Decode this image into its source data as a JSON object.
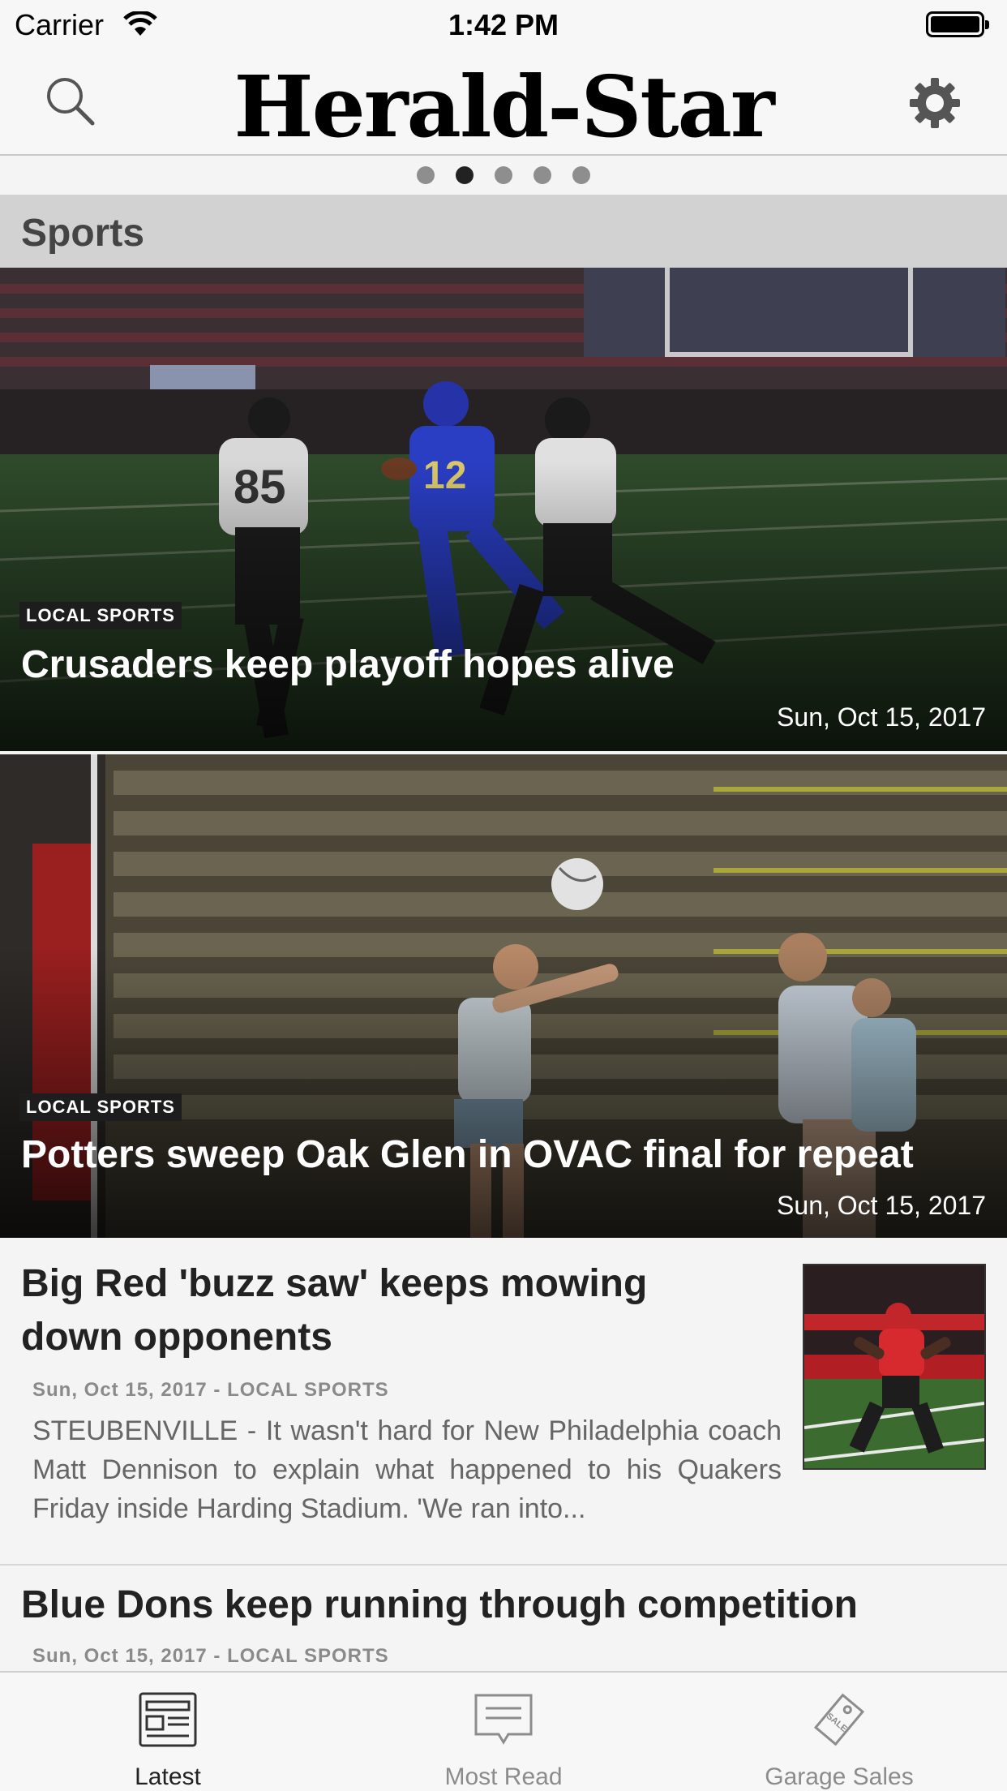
{
  "status_bar": {
    "carrier": "Carrier",
    "time": "1:42 PM"
  },
  "header": {
    "logo": "Herald-Star"
  },
  "pager": {
    "count": 5,
    "active_index": 1
  },
  "section": {
    "title": "Sports"
  },
  "hero_stories": [
    {
      "tag": "LOCAL SPORTS",
      "title": "Crusaders keep playoff hopes alive",
      "date": "Sun, Oct 15, 2017"
    },
    {
      "tag": "LOCAL SPORTS",
      "title": "Potters sweep Oak Glen in OVAC final for repeat",
      "date": "Sun, Oct 15, 2017"
    }
  ],
  "articles": [
    {
      "title": "Big Red 'buzz saw' keeps mowing down opponents",
      "meta": "Sun, Oct 15, 2017 - LOCAL SPORTS",
      "snippet": "STEUBENVILLE - It wasn't hard for New Philadelphia coach Matt Dennison to explain what happened to his Quakers Friday inside Harding Stadium. 'We ran into..."
    },
    {
      "title": "Blue Dons keep running through competition",
      "meta": "Sun, Oct 15, 2017 - LOCAL SPORTS"
    }
  ],
  "tabs": [
    {
      "label": "Latest",
      "icon": "newspaper-icon",
      "active": true
    },
    {
      "label": "Most Read",
      "icon": "message-icon",
      "active": false
    },
    {
      "label": "Garage Sales",
      "icon": "sale-tag-icon",
      "active": false
    }
  ]
}
